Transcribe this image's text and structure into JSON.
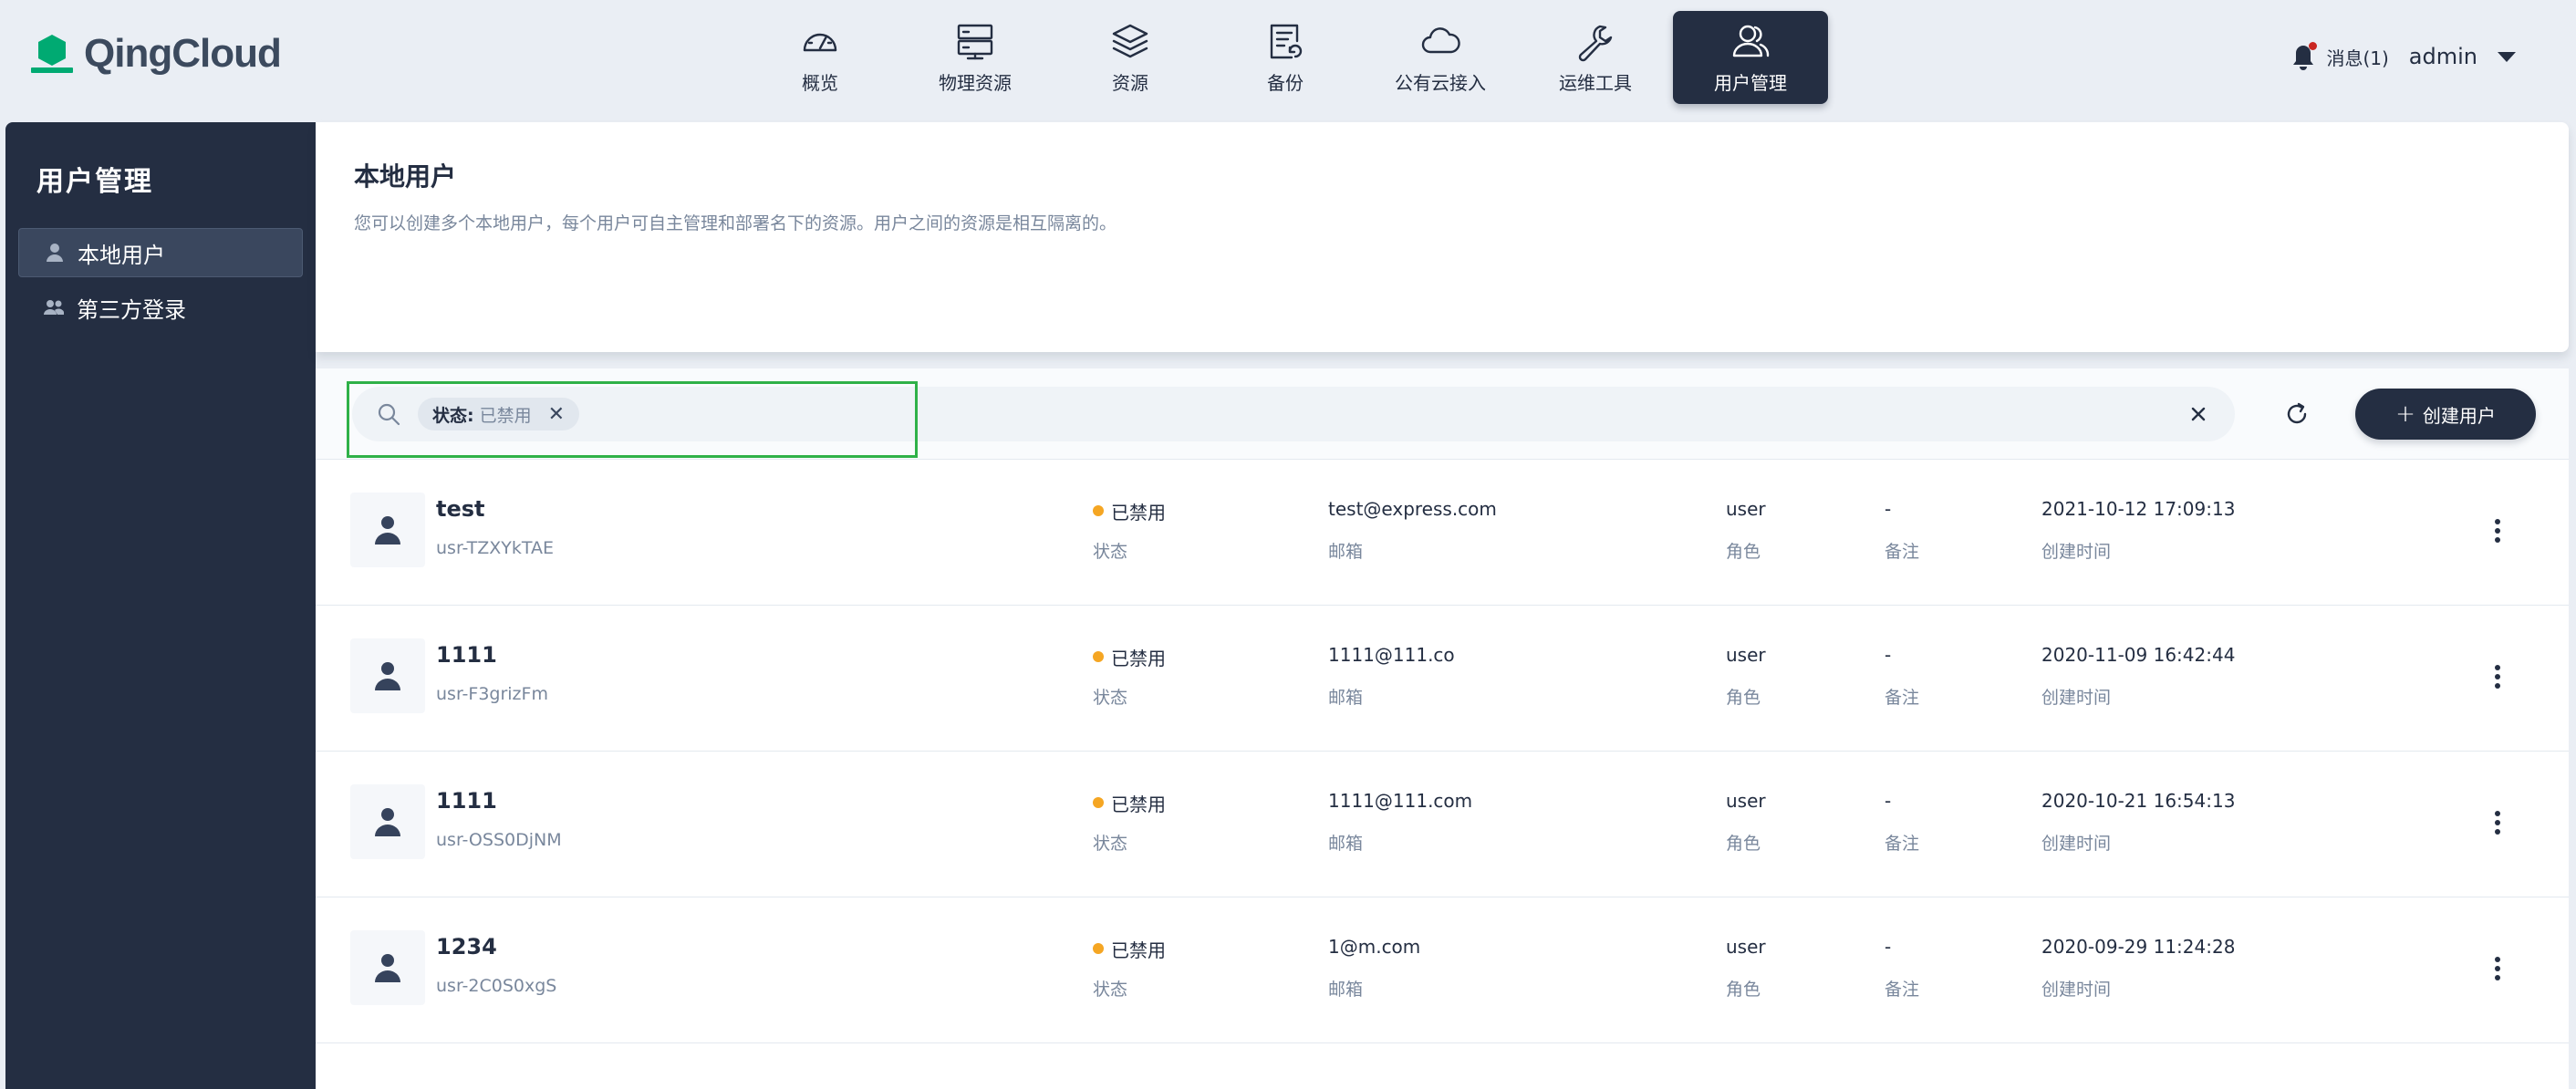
{
  "brand": {
    "name": "QingCloud"
  },
  "nav": [
    {
      "label": "概览",
      "icon": "dashboard-gauge-icon"
    },
    {
      "label": "物理资源",
      "icon": "server-icon"
    },
    {
      "label": "资源",
      "icon": "layers-icon"
    },
    {
      "label": "备份",
      "icon": "backup-document-icon"
    },
    {
      "label": "公有云接入",
      "icon": "cloud-icon"
    },
    {
      "label": "运维工具",
      "icon": "wrench-icon"
    },
    {
      "label": "用户管理",
      "icon": "users-icon",
      "active": true
    }
  ],
  "topright": {
    "messages": "消息(1)",
    "user": "admin"
  },
  "sidebar": {
    "title": "用户管理",
    "items": [
      {
        "label": "本地用户",
        "icon": "user-icon",
        "active": true
      },
      {
        "label": "第三方登录",
        "icon": "users-group-icon",
        "active": false
      }
    ]
  },
  "page": {
    "title": "本地用户",
    "description": "您可以创建多个本地用户，每个用户可自主管理和部署名下的资源。用户之间的资源是相互隔离的。"
  },
  "toolbar": {
    "filter_key": "状态:",
    "filter_value": "已禁用",
    "create_label": "创建用户"
  },
  "columns": {
    "status": "状态",
    "email": "邮箱",
    "role": "角色",
    "note": "备注",
    "created": "创建时间"
  },
  "users": [
    {
      "name": "test",
      "id": "usr-TZXYkTAE",
      "status": "已禁用",
      "email": "test@express.com",
      "role": "user",
      "note": "-",
      "created": "2021-10-12 17:09:13"
    },
    {
      "name": "1111",
      "id": "usr-F3grizFm",
      "status": "已禁用",
      "email": "1111@111.co",
      "role": "user",
      "note": "-",
      "created": "2020-11-09 16:42:44"
    },
    {
      "name": "1111",
      "id": "usr-OSS0DjNM",
      "status": "已禁用",
      "email": "1111@111.com",
      "role": "user",
      "note": "-",
      "created": "2020-10-21 16:54:13"
    },
    {
      "name": "1234",
      "id": "usr-2C0S0xgS",
      "status": "已禁用",
      "email": "1@m.com",
      "role": "user",
      "note": "-",
      "created": "2020-09-29 11:24:28"
    }
  ],
  "colors": {
    "primary_dark": "#242e42",
    "status_disabled": "#f5a623",
    "highlight_green": "#2fb148",
    "notification_red": "#ca2621"
  }
}
